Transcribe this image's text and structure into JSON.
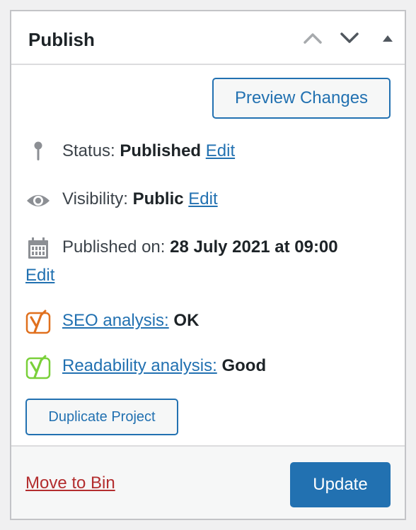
{
  "panel": {
    "title": "Publish",
    "controls": {
      "move_up_icon": "chevron-up-icon",
      "move_down_icon": "chevron-down-icon",
      "toggle_icon": "triangle-up-icon"
    }
  },
  "actions": {
    "preview_label": "Preview Changes"
  },
  "status": {
    "icon": "pin-icon",
    "label": "Status:",
    "value": "Published",
    "edit": "Edit"
  },
  "visibility": {
    "icon": "eye-icon",
    "label": "Visibility:",
    "value": "Public",
    "edit": "Edit"
  },
  "published_on": {
    "icon": "calendar-icon",
    "label": "Published on:",
    "value": "28 July 2021 at 09:00",
    "edit": "Edit"
  },
  "seo": {
    "icon": "yoast-orange-icon",
    "link": "SEO analysis:",
    "value": "OK",
    "color": "#e0701e"
  },
  "readability": {
    "icon": "yoast-green-icon",
    "link": "Readability analysis:",
    "value": "Good",
    "color": "#7ad03a"
  },
  "duplicate": {
    "label": "Duplicate Project"
  },
  "footer": {
    "move_to_bin": "Move to Bin",
    "update": "Update"
  },
  "colors": {
    "accent": "#2271b1",
    "danger": "#b32d2e"
  }
}
